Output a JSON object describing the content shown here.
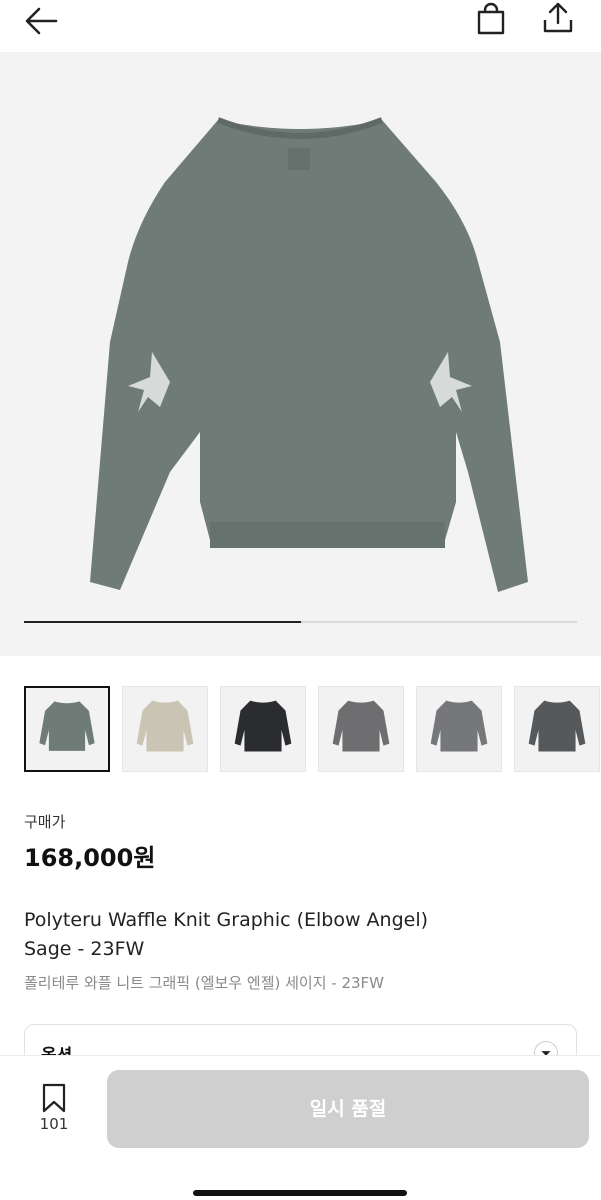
{
  "nav": {
    "back_icon": "arrow-left-icon",
    "bag_icon": "shopping-bag-icon",
    "share_icon": "share-icon"
  },
  "gallery": {
    "progress": 0.5,
    "thumbnails": [
      {
        "color": "Sage",
        "fill": "#6f7b77",
        "selected": true
      },
      {
        "color": "Beige",
        "fill": "#c9c4b3",
        "selected": false
      },
      {
        "color": "Black",
        "fill": "#2b2c30",
        "selected": false
      },
      {
        "color": "Grey",
        "fill": "#6e6e70",
        "selected": false
      },
      {
        "color": "Grey",
        "fill": "#75777a",
        "selected": false
      },
      {
        "color": "Charcoal",
        "fill": "#56595c",
        "selected": false
      }
    ]
  },
  "product": {
    "price_label": "구매가",
    "price": "168,000원",
    "title_en_line1": "Polyteru Waffle Knit Graphic (Elbow Angel)",
    "title_en_line2": "Sage - 23FW",
    "title_ko": "폴리테루 와플 니트 그래픽 (엘보우 엔젤) 세이지 - 23FW"
  },
  "option": {
    "label": "옵션"
  },
  "bottom": {
    "wish_count": "101",
    "sold_out_label": "일시 품절"
  },
  "colors": {
    "sweater": "#6f7b77",
    "button_disabled": "#cfcfcf"
  }
}
